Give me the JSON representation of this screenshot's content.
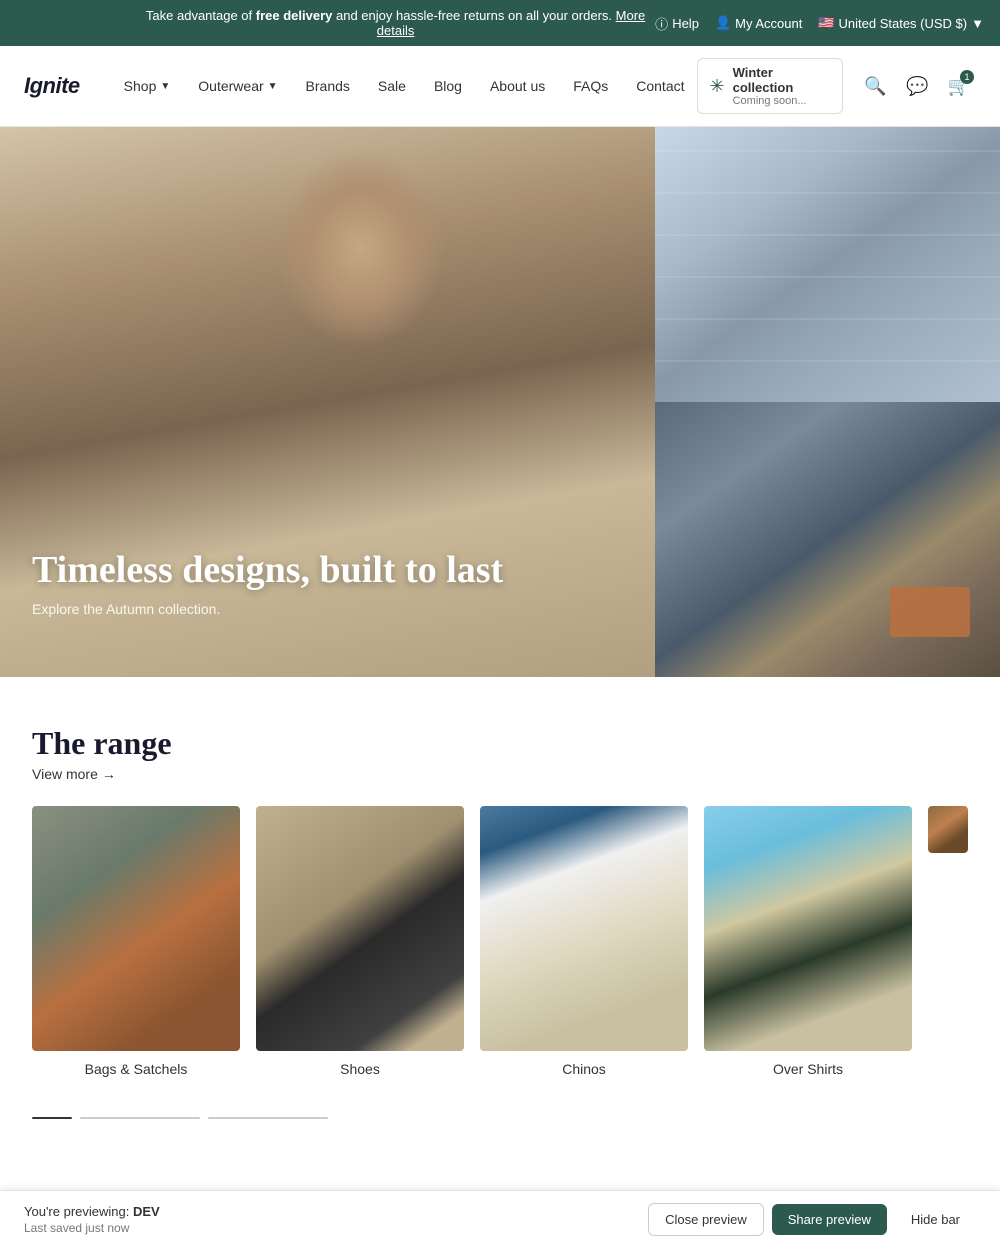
{
  "announcement": {
    "text_prefix": "Take advantage of ",
    "bold_text": "free delivery",
    "text_suffix": " and enjoy hassle-free returns on all your orders.",
    "link_text": "More details",
    "right": {
      "help": "Help",
      "account": "My Account",
      "region": "United States (USD $)"
    }
  },
  "navbar": {
    "logo": "Ignite",
    "links": [
      {
        "label": "Shop",
        "has_dropdown": true
      },
      {
        "label": "Outerwear",
        "has_dropdown": true
      },
      {
        "label": "Brands",
        "has_dropdown": false
      },
      {
        "label": "Sale",
        "has_dropdown": false
      },
      {
        "label": "Blog",
        "has_dropdown": false
      },
      {
        "label": "About us",
        "has_dropdown": false
      },
      {
        "label": "FAQs",
        "has_dropdown": false
      },
      {
        "label": "Contact",
        "has_dropdown": false
      }
    ],
    "winter_badge": {
      "title": "Winter collection",
      "subtitle": "Coming soon..."
    },
    "cart_count": "1"
  },
  "hero": {
    "headline": "Timeless designs, built to last",
    "subtext": "Explore the Autumn collection."
  },
  "range": {
    "title": "The range",
    "view_more": "View more",
    "items": [
      {
        "label": "Bags & Satchels"
      },
      {
        "label": "Shoes"
      },
      {
        "label": "Chinos"
      },
      {
        "label": "Over Shirts"
      }
    ]
  },
  "preview_bar": {
    "label": "You're previewing:",
    "env": "DEV",
    "last_saved": "Last saved just now",
    "close_label": "Close preview",
    "share_label": "Share preview",
    "hide_label": "Hide bar"
  }
}
